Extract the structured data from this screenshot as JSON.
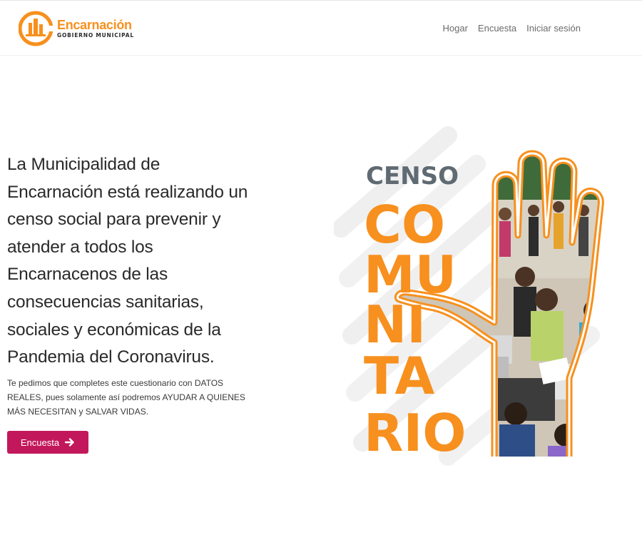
{
  "header": {
    "logo": {
      "name": "Encarnación",
      "subtitle": "GOBIERNO MUNICIPAL"
    },
    "nav": [
      {
        "label": "Hogar"
      },
      {
        "label": "Encuesta"
      },
      {
        "label": "Iniciar sesión"
      }
    ]
  },
  "hero": {
    "title_lines": [
      "La Municipalidad de",
      "Encarnación está realizando un",
      "censo social para prevenir y",
      "atender a todos los",
      "Encarnacenos de las",
      "consecuencias sanitarias,",
      "sociales y económicas de la",
      "Pandemia del Coronavirus."
    ],
    "subtitle_lines": [
      "Te pedimos que completes este cuestionario con DATOS",
      "REALES, pues solamente así podremos AYUDAR A QUIENES",
      "MÁS NECESITAN y SALVAR VIDAS."
    ],
    "cta_label": "Encuesta",
    "cta_icon": "arrow-right-icon"
  },
  "graphic": {
    "label_top": "CENSO",
    "word_lines": [
      "CO",
      "MU",
      "NI",
      "TA",
      "RIO"
    ],
    "colors": {
      "orange": "#f7901e",
      "gray": "#5f6a72",
      "stripe": "#eeeeef",
      "hand_outline": "#f7901e"
    }
  },
  "colors": {
    "brand_orange": "#f7901e",
    "cta": "#c2185b",
    "nav_text": "#6b6b6b"
  }
}
